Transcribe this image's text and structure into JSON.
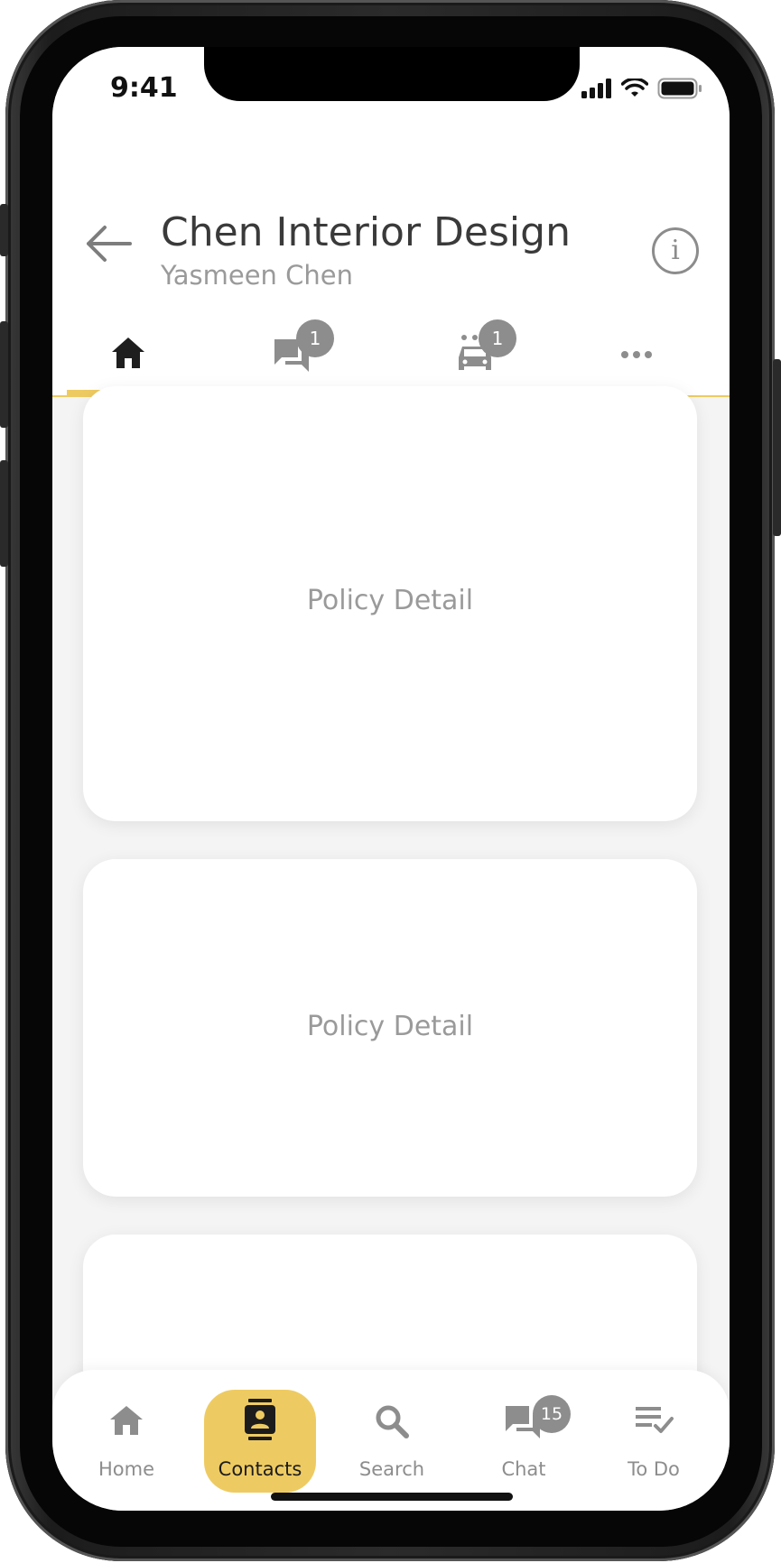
{
  "status_bar": {
    "time": "9:41"
  },
  "header": {
    "title": "Chen Interior Design",
    "subtitle": "Yasmeen Chen",
    "info_glyph": "i"
  },
  "tabs": [
    {
      "icon": "home-icon",
      "active": true
    },
    {
      "icon": "chat-bubbles-icon",
      "badge": "1"
    },
    {
      "icon": "car-wash-icon",
      "badge": "1"
    },
    {
      "icon": "more-icon"
    }
  ],
  "cards": [
    {
      "label": "Policy Detail"
    },
    {
      "label": "Policy Detail"
    },
    {
      "label": ""
    }
  ],
  "bottom_nav": [
    {
      "label": "Home",
      "icon": "home-icon"
    },
    {
      "label": "Contacts",
      "icon": "contacts-icon",
      "active": true
    },
    {
      "label": "Search",
      "icon": "search-icon"
    },
    {
      "label": "Chat",
      "icon": "chat-icon",
      "badge": "15"
    },
    {
      "label": "To Do",
      "icon": "todo-icon"
    }
  ],
  "colors": {
    "accent": "#eecb62",
    "muted": "#8d8d8d",
    "title": "#3a3a3a",
    "background": "#f4f4f4"
  }
}
